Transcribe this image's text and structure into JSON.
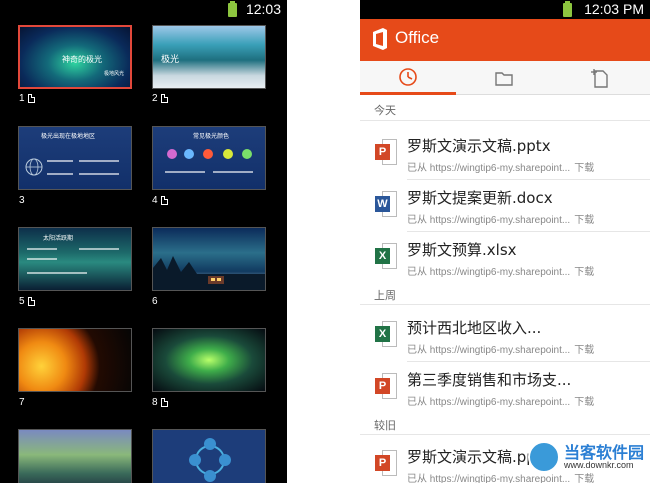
{
  "left_panel": {
    "status": {
      "time": "12:03"
    },
    "slides": [
      {
        "label": "1",
        "has_notes": true,
        "title": "神奇的极光",
        "subtitle": "极地风光"
      },
      {
        "label": "2",
        "has_notes": true,
        "title": "极光"
      },
      {
        "label": "3",
        "has_notes": false,
        "title": "极光出现在极地地区"
      },
      {
        "label": "4",
        "has_notes": true,
        "title": "常见极光颜色"
      },
      {
        "label": "5",
        "has_notes": true,
        "title": "太阳活跃期"
      },
      {
        "label": "6",
        "has_notes": false
      },
      {
        "label": "7",
        "has_notes": false
      },
      {
        "label": "8",
        "has_notes": true
      }
    ]
  },
  "right_panel": {
    "status": {
      "time": "12:03 PM"
    },
    "app_title": "Office",
    "accent_color": "#e64a19",
    "tabs": [
      {
        "icon": "clock-icon",
        "active": true
      },
      {
        "icon": "folder-icon",
        "active": false
      },
      {
        "icon": "new-document-icon",
        "active": false
      }
    ],
    "sections": {
      "today": "今天",
      "last_week": "上周",
      "older": "较旧"
    },
    "files": [
      {
        "name": "罗斯文演示文稿.pptx",
        "type": "pptx",
        "badge": "P",
        "path": "已从 https://wingtip6-my.sharepoint...",
        "action": "下载"
      },
      {
        "name": "罗斯文提案更新.docx",
        "type": "docx",
        "badge": "W",
        "path": "已从 https://wingtip6-my.sharepoint...",
        "action": "下载"
      },
      {
        "name": "罗斯文预算.xlsx",
        "type": "xlsx",
        "badge": "X",
        "path": "已从 https://wingtip6-my.sharepoint...",
        "action": "下载"
      },
      {
        "name": "预计西北地区收入...",
        "type": "xlsx",
        "badge": "X",
        "path": "已从 https://wingtip6-my.sharepoint...",
        "action": "下载"
      },
      {
        "name": "第三季度销售和市场支...",
        "type": "pptx",
        "badge": "P",
        "path": "已从 https://wingtip6-my.sharepoint...",
        "action": "下载"
      },
      {
        "name": "罗斯文演示文稿.pptx",
        "type": "pptx",
        "badge": "P",
        "path": "已从 https://wingtip6-my.sharepoint...",
        "action": "下载"
      }
    ]
  },
  "watermark": {
    "name": "当客软件园",
    "url": "www.downkr.com"
  }
}
